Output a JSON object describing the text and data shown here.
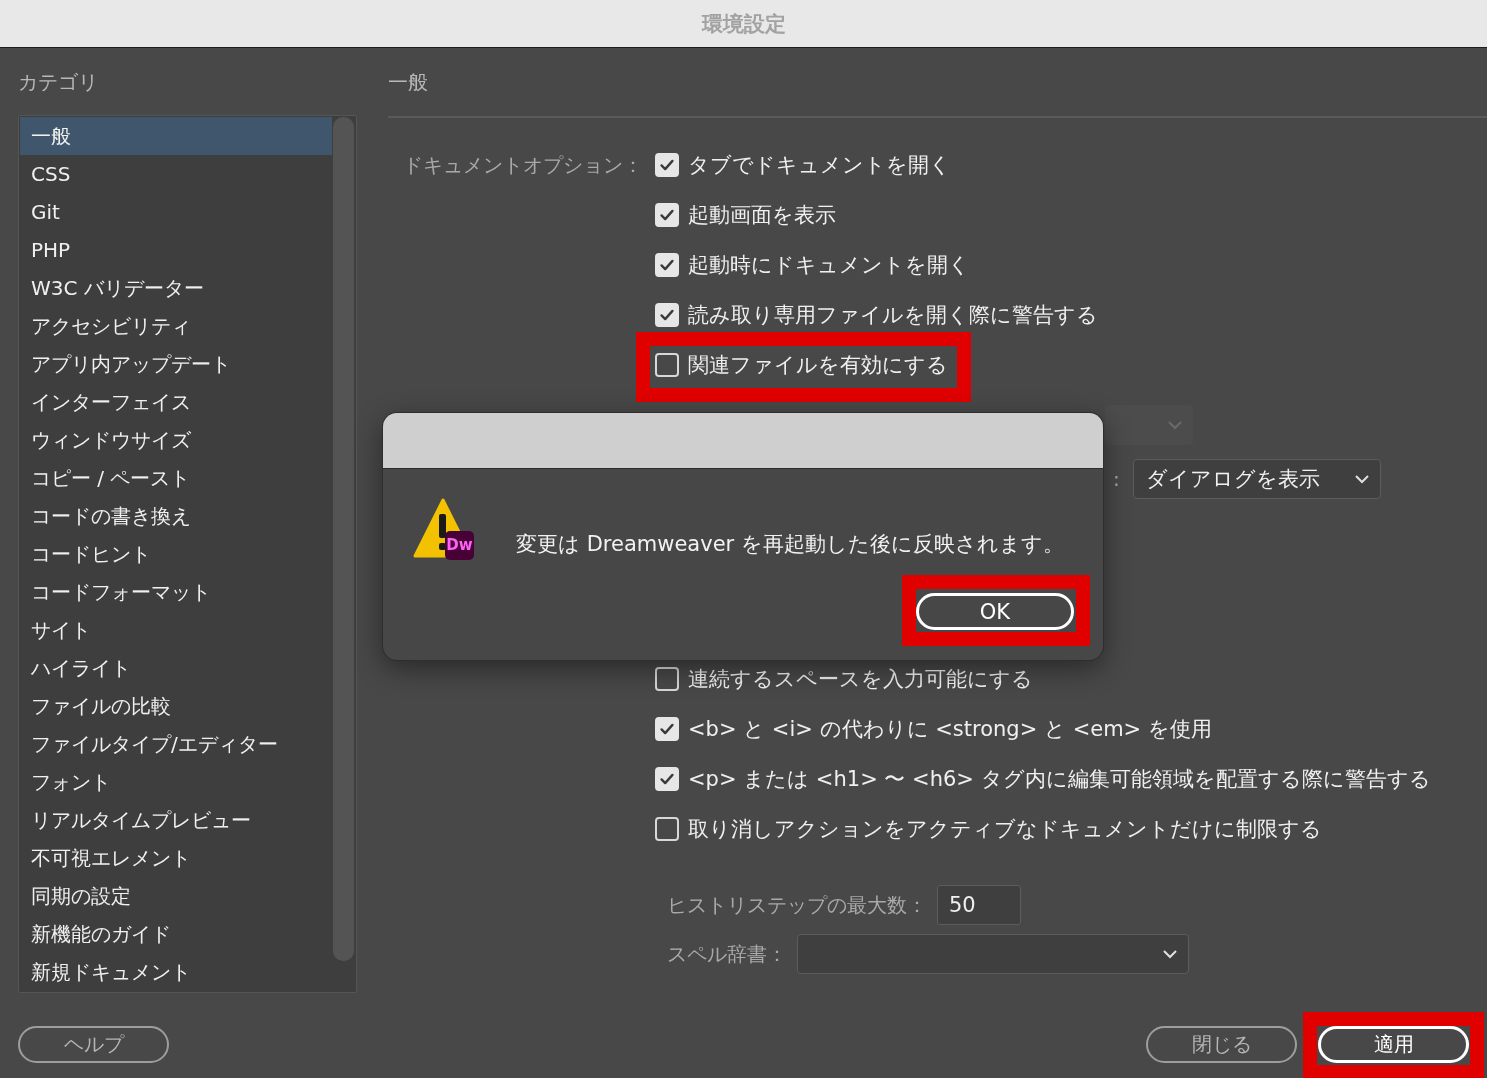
{
  "window": {
    "title": "環境設定"
  },
  "sidebar": {
    "heading": "カテゴリ",
    "items": [
      {
        "label": "一般",
        "selected": true
      },
      {
        "label": "CSS",
        "selected": false
      },
      {
        "label": "Git",
        "selected": false
      },
      {
        "label": "PHP",
        "selected": false
      },
      {
        "label": "W3C バリデーター",
        "selected": false
      },
      {
        "label": "アクセシビリティ",
        "selected": false
      },
      {
        "label": "アプリ内アップデート",
        "selected": false
      },
      {
        "label": "インターフェイス",
        "selected": false
      },
      {
        "label": "ウィンドウサイズ",
        "selected": false
      },
      {
        "label": "コピー / ペースト",
        "selected": false
      },
      {
        "label": "コードの書き換え",
        "selected": false
      },
      {
        "label": "コードヒント",
        "selected": false
      },
      {
        "label": "コードフォーマット",
        "selected": false
      },
      {
        "label": "サイト",
        "selected": false
      },
      {
        "label": "ハイライト",
        "selected": false
      },
      {
        "label": "ファイルの比較",
        "selected": false
      },
      {
        "label": "ファイルタイプ/エディター",
        "selected": false
      },
      {
        "label": "フォント",
        "selected": false
      },
      {
        "label": "リアルタイムプレビュー",
        "selected": false
      },
      {
        "label": "不可視エレメント",
        "selected": false
      },
      {
        "label": "同期の設定",
        "selected": false
      },
      {
        "label": "新機能のガイド",
        "selected": false
      },
      {
        "label": "新規ドキュメント",
        "selected": false
      }
    ]
  },
  "panel": {
    "heading": "一般",
    "document_options": {
      "label": "ドキュメントオプション：",
      "items": [
        {
          "label": "タブでドキュメントを開く",
          "checked": true,
          "highlighted": false
        },
        {
          "label": "起動画面を表示",
          "checked": true,
          "highlighted": false
        },
        {
          "label": "起動時にドキュメントを開く",
          "checked": true,
          "highlighted": false
        },
        {
          "label": "読み取り専用ファイルを開く際に警告する",
          "checked": true,
          "highlighted": false
        },
        {
          "label": "関連ファイルを有効にする",
          "checked": false,
          "highlighted": true
        }
      ]
    },
    "dialog_select": {
      "separator": ":",
      "value": "ダイアログを表示"
    },
    "editing_options": [
      {
        "label": "連続するスペースを入力可能にする",
        "checked": false
      },
      {
        "label": "<b> と <i> の代わりに <strong> と <em> を使用",
        "checked": true
      },
      {
        "label": "<p> または <h1> 〜 <h6> タグ内に編集可能領域を配置する際に警告する",
        "checked": true
      },
      {
        "label": "取り消しアクションをアクティブなドキュメントだけに制限する",
        "checked": false
      }
    ],
    "history_steps": {
      "label": "ヒストリステップの最大数：",
      "value": "50"
    },
    "spelling_dictionary": {
      "label": "スペル辞書："
    }
  },
  "buttons": [
    {
      "label": "ヘルプ",
      "kind": "left",
      "highlighted": false
    },
    {
      "label": "閉じる",
      "kind": "right",
      "highlighted": false
    },
    {
      "label": "適用",
      "kind": "primary",
      "highlighted": true
    }
  ],
  "alert": {
    "badge": "Dw",
    "message": "変更は Dreamweaver を再起動した後に反映されます。",
    "button": {
      "label": "OK",
      "highlighted": true
    }
  }
}
